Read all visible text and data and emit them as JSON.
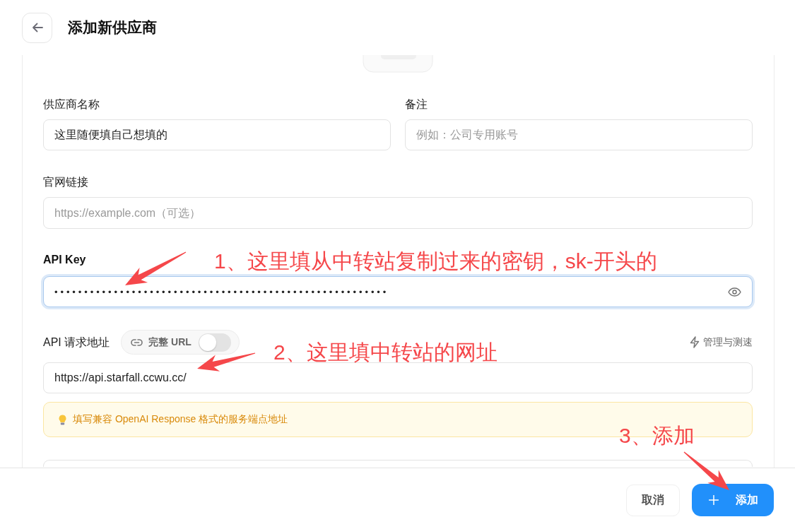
{
  "header": {
    "title": "添加新供应商"
  },
  "form": {
    "row": [
      {
        "label": "供应商名称",
        "value": "这里随便填自己想填的"
      },
      {
        "label": "备注",
        "placeholder": "例如：公司专用账号"
      }
    ],
    "website": {
      "label": "官网链接",
      "placeholder": "https://example.com（可选）"
    },
    "api_key": {
      "label": "API Key",
      "value": "••••••••••••••••••••••••••••••••••••••••••••••••••••••••",
      "focused": true
    },
    "endpoint": {
      "label": "API 请求地址",
      "full_url_toggle": {
        "label": "完整 URL",
        "on": false
      },
      "manage_link": "管理与测速",
      "value": "https://api.starfall.ccwu.cc/",
      "hint": "填写兼容 OpenAI Response 格式的服务端点地址"
    }
  },
  "footer": {
    "buttons": [
      {
        "label": "取消",
        "kind": "secondary"
      },
      {
        "label": "添加",
        "kind": "primary"
      }
    ]
  },
  "annotations": [
    {
      "text": "1、这里填从中转站复制过来的密钥，sk-开头的"
    },
    {
      "text": "2、这里填中转站的网址"
    },
    {
      "text": "3、添加"
    }
  ]
}
